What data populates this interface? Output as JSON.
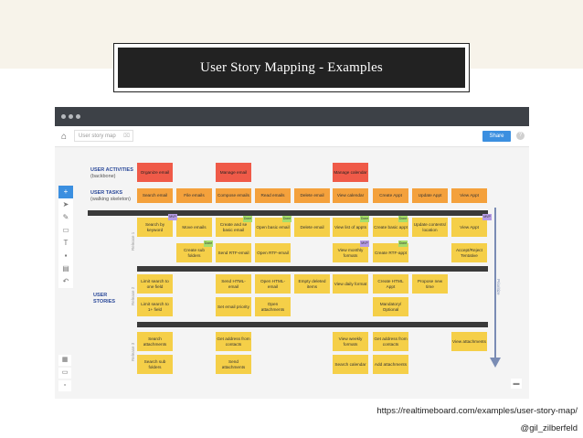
{
  "slide": {
    "title": "User Story Mapping - Examples",
    "source_url": "https://realtimeboard.com/examples/user-story-map/",
    "author": "@gil_zilberfeld"
  },
  "app": {
    "board_name": "User story map",
    "share_label": "Share",
    "help_label": "?"
  },
  "labels": {
    "activities_title": "USER ACTIVITIES",
    "activities_sub": "(backbone)",
    "tasks_title": "USER TASKS",
    "tasks_sub": "(walking skeleton)",
    "stories_title": "USER",
    "stories_title2": "STORIES",
    "prioritize": "Prioritize",
    "release1": "Release 1",
    "release2": "Release 2",
    "release3": "Release 3"
  },
  "activities": [
    "Organize email",
    "Manage email",
    "Manage calendar"
  ],
  "tasks": [
    "Search email",
    "File emails",
    "Compose emails",
    "Read emails",
    "Delete email",
    "View calendar",
    "Create Appt",
    "Update Appt",
    "View Appt"
  ],
  "stories": {
    "r1a": [
      "Search by keyword",
      "Move emails",
      "Create and se basic email",
      "Open basic email",
      "Delete email",
      "View list of appts",
      "Create basic appt",
      "Update contents/ location",
      "View Appt"
    ],
    "r1b": [
      "Create sub folders",
      "Send RTF-email",
      "Open RTF-email",
      "View monthly formats",
      "Create RTF-appt",
      "Accept/Reject Tentative"
    ],
    "r2a": [
      "Limit search to one field",
      "Send HTML-email",
      "Open HTML-email",
      "Empty deleted items",
      "View daily format",
      "Create HTML Appt",
      "Propose new time"
    ],
    "r2b": [
      "Limit search to 1+ field",
      "Set email priority",
      "Open attachments",
      "Mandatory/ Optional"
    ],
    "r3a": [
      "Search attachments",
      "Get address from contacts",
      "View weekly formats",
      "Get address from contacts",
      "View attachments"
    ],
    "r3b": [
      "Search sub folders",
      "Send attachments",
      "Search calendar",
      "Add attachments"
    ]
  },
  "tags": {
    "done": "Done",
    "mvp": "MVP"
  },
  "toolbar_icons": [
    "plus-icon",
    "cursor-icon",
    "pen-icon",
    "shape-icon",
    "text-icon",
    "sticky-note-icon",
    "frame-icon",
    "undo-icon"
  ]
}
